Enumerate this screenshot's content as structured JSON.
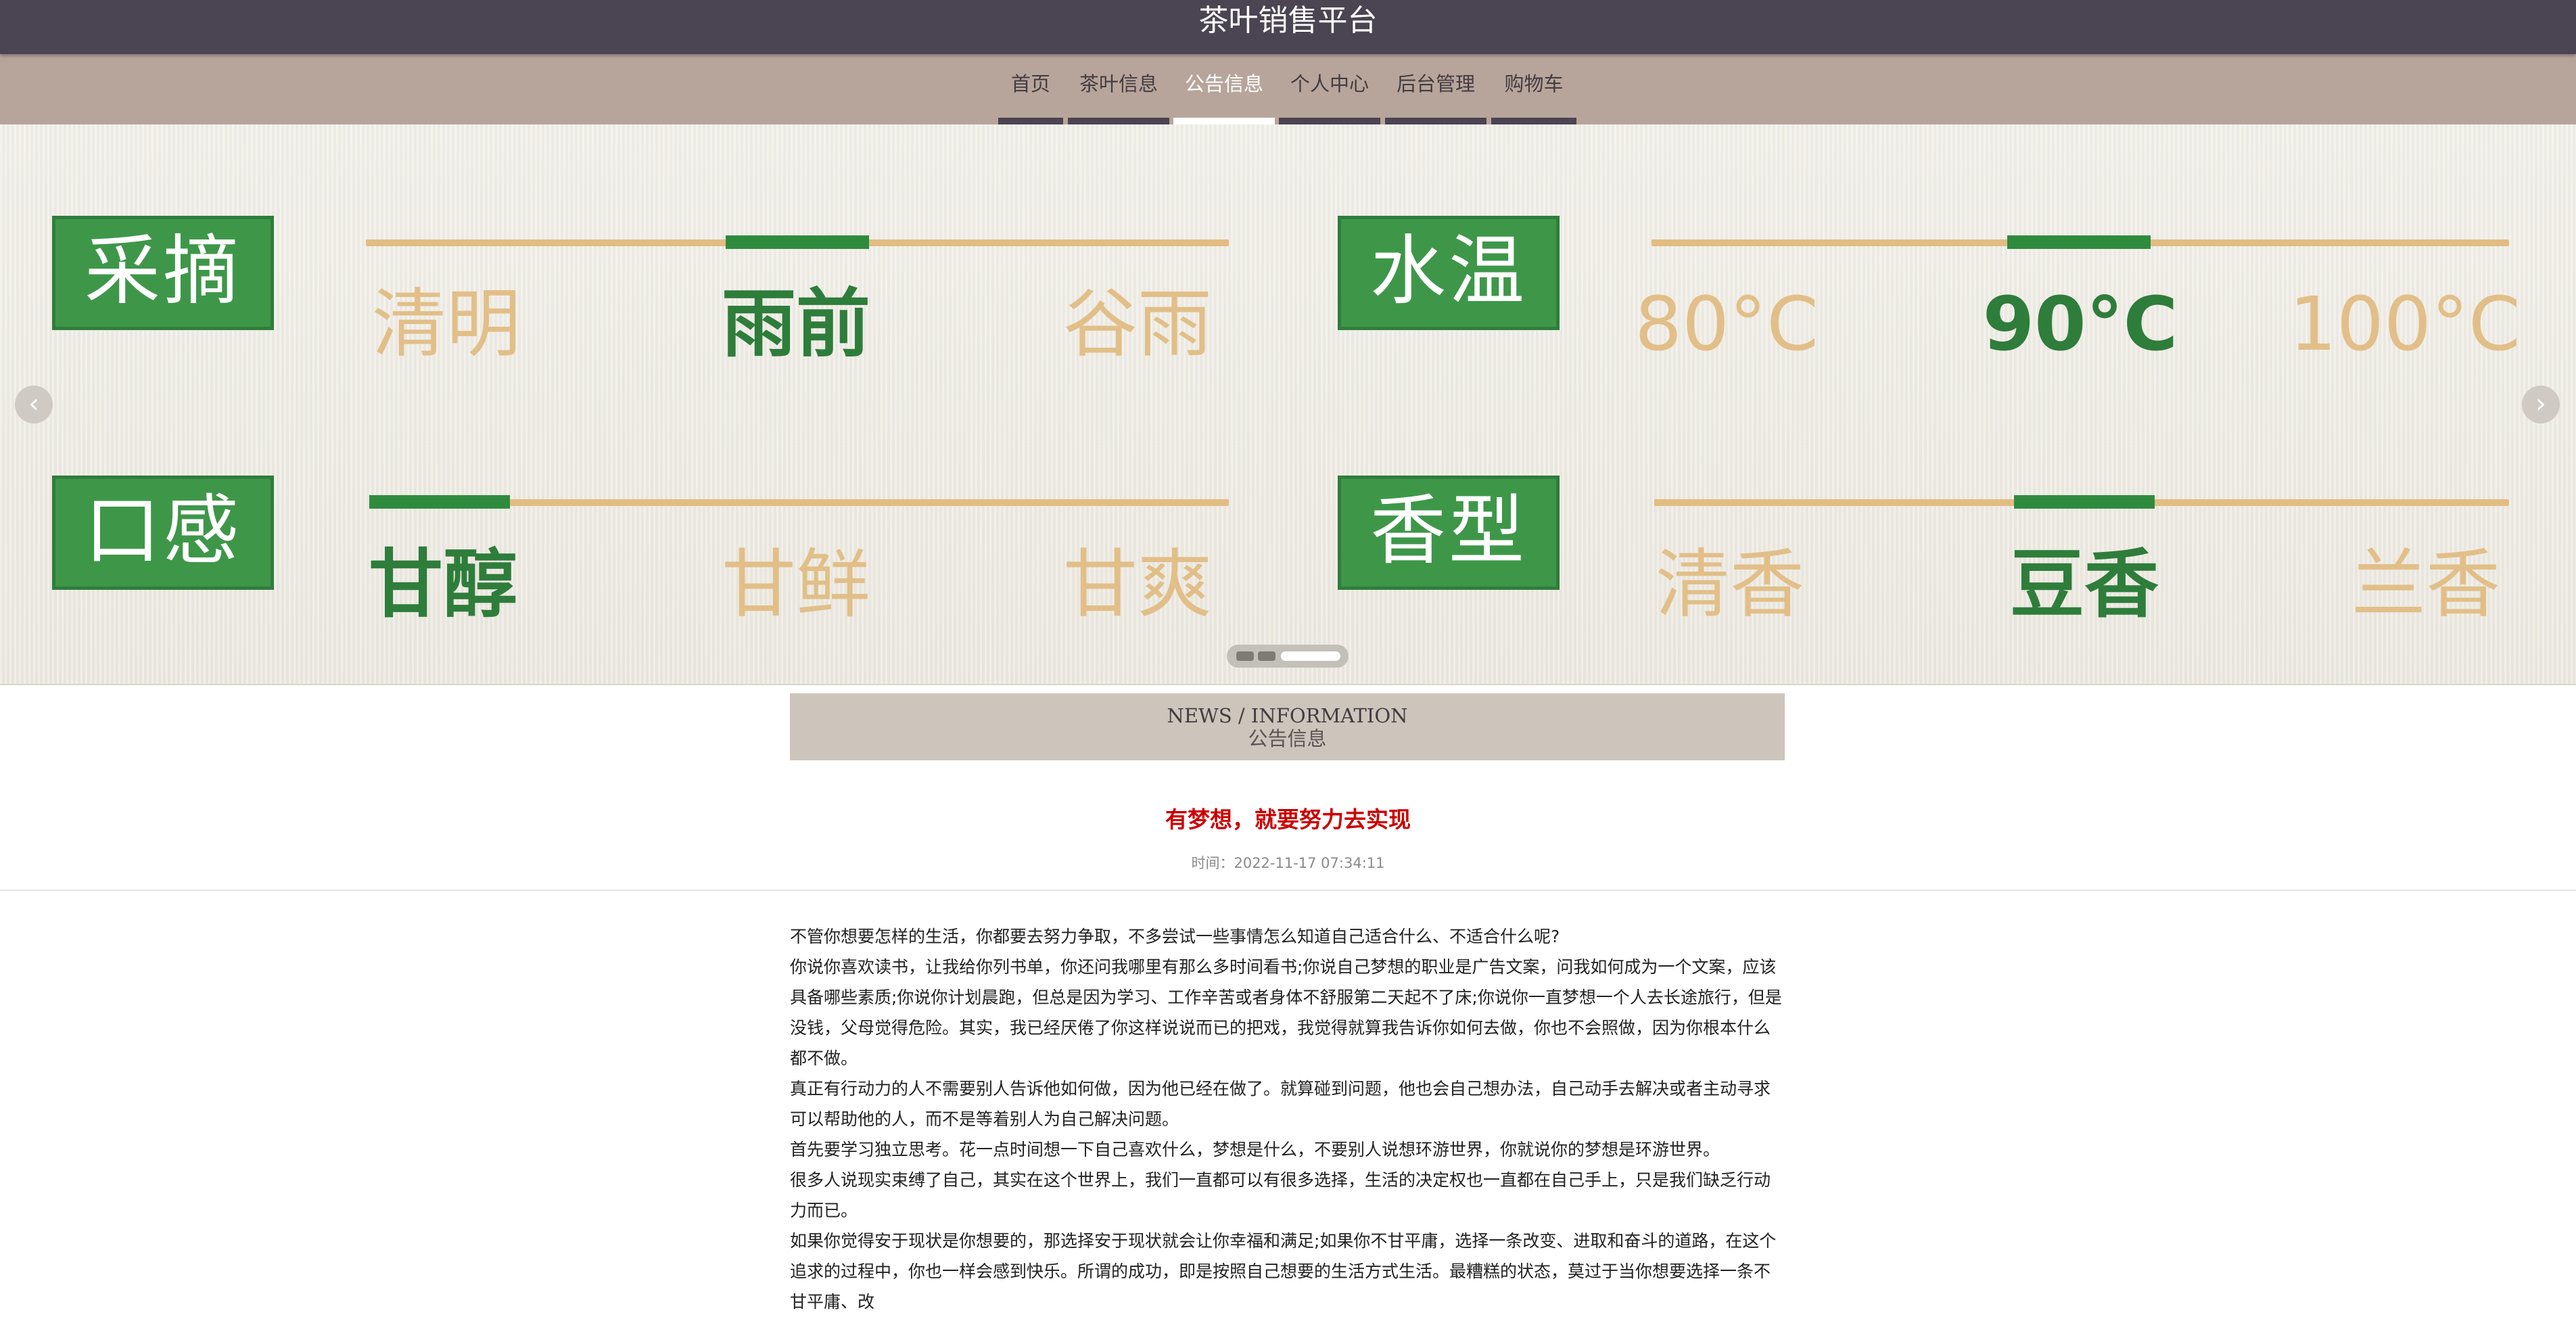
{
  "header": {
    "title": "茶叶销售平台"
  },
  "nav": {
    "items": [
      {
        "label": "首页",
        "active": false
      },
      {
        "label": "茶叶信息",
        "active": false
      },
      {
        "label": "公告信息",
        "active": true
      },
      {
        "label": "个人中心",
        "active": false
      },
      {
        "label": "后台管理",
        "active": false
      },
      {
        "label": "购物车",
        "active": false
      }
    ]
  },
  "carousel": {
    "prev_icon": "chevron-left-icon",
    "next_icon": "chevron-right-icon",
    "active_slide": 3,
    "slide_count": 3,
    "slide": {
      "panels": [
        {
          "label": "采摘",
          "options": [
            "清明",
            "雨前",
            "谷雨"
          ],
          "selected": 1
        },
        {
          "label": "水温",
          "options": [
            "80°C",
            "90°C",
            "100°C"
          ],
          "selected": 1
        },
        {
          "label": "口感",
          "options": [
            "甘醇",
            "甘鲜",
            "甘爽"
          ],
          "selected": 0
        },
        {
          "label": "香型",
          "options": [
            "清香",
            "豆香",
            "兰香"
          ],
          "selected": 1
        }
      ]
    }
  },
  "section": {
    "title_en": "NEWS / INFORMATION",
    "title_zh": "公告信息"
  },
  "news": {
    "title": "有梦想，就要努力去实现",
    "time": "时间：2022-11-17 07:34:11",
    "paragraphs": [
      "不管你想要怎样的生活，你都要去努力争取，不多尝试一些事情怎么知道自己适合什么、不适合什么呢?",
      "你说你喜欢读书，让我给你列书单，你还问我哪里有那么多时间看书;你说自己梦想的职业是广告文案，问我如何成为一个文案，应该具备哪些素质;你说你计划晨跑，但总是因为学习、工作辛苦或者身体不舒服第二天起不了床;你说你一直梦想一个人去长途旅行，但是没钱，父母觉得危险。其实，我已经厌倦了你这样说说而已的把戏，我觉得就算我告诉你如何去做，你也不会照做，因为你根本什么都不做。",
      "真正有行动力的人不需要别人告诉他如何做，因为他已经在做了。就算碰到问题，他也会自己想办法，自己动手去解决或者主动寻求可以帮助他的人，而不是等着别人为自己解决问题。",
      "首先要学习独立思考。花一点时间想一下自己喜欢什么，梦想是什么，不要别人说想环游世界，你就说你的梦想是环游世界。",
      "很多人说现实束缚了自己，其实在这个世界上，我们一直都可以有很多选择，生活的决定权也一直都在自己手上，只是我们缺乏行动力而已。",
      "如果你觉得安于现状是你想要的，那选择安于现状就会让你幸福和满足;如果你不甘平庸，选择一条改变、进取和奋斗的道路，在这个追求的过程中，你也一样会感到快乐。所谓的成功，即是按照自己想要的生活方式生活。最糟糕的状态，莫过于当你想要选择一条不甘平庸、改"
    ]
  }
}
